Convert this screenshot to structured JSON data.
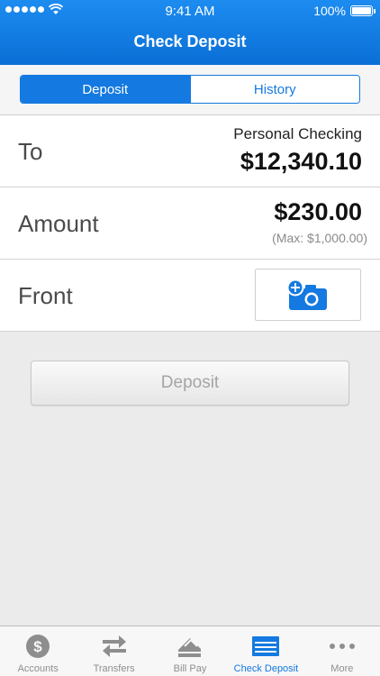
{
  "status_bar": {
    "time": "9:41 AM",
    "battery": "100%"
  },
  "header": {
    "title": "Check Deposit"
  },
  "segments": [
    {
      "label": "Deposit",
      "active": true
    },
    {
      "label": "History",
      "active": false
    }
  ],
  "to_row": {
    "label": "To",
    "account": "Personal Checking",
    "balance": "$12,340.10"
  },
  "amount_row": {
    "label": "Amount",
    "value": "$230.00",
    "max": "(Max: $1,000.00)"
  },
  "front_row": {
    "label": "Front",
    "camera_icon": "add-camera-icon"
  },
  "deposit_button": {
    "label": "Deposit"
  },
  "tabbar": [
    {
      "label": "Accounts",
      "icon": "dollar-icon",
      "active": false
    },
    {
      "label": "Transfers",
      "icon": "transfer-arrows-icon",
      "active": false
    },
    {
      "label": "Bill Pay",
      "icon": "bill-pay-icon",
      "active": false
    },
    {
      "label": "Check Deposit",
      "icon": "check-icon",
      "active": true
    },
    {
      "label": "More",
      "icon": "more-dots-icon",
      "active": false
    }
  ],
  "colors": {
    "accent": "#1479e0",
    "header_top": "#1d8cf0",
    "header_bottom": "#0a6fd6",
    "inactive": "#8e8e8e"
  }
}
